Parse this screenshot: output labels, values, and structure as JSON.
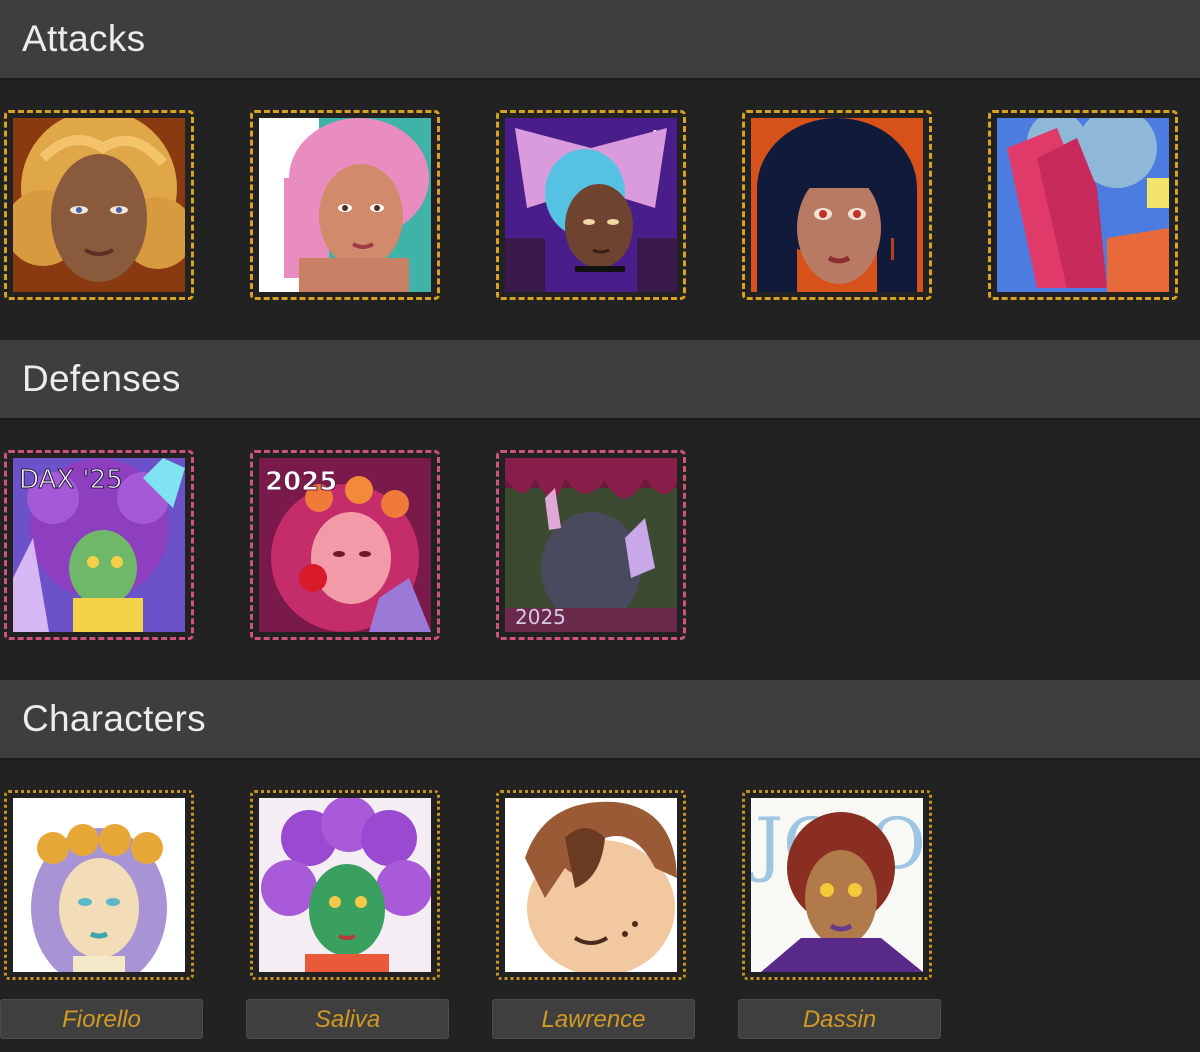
{
  "sections": {
    "attacks": {
      "title": "Attacks"
    },
    "defenses": {
      "title": "Defenses"
    },
    "characters": {
      "title": "Characters"
    }
  },
  "characters": [
    {
      "name": "Fiorello"
    },
    {
      "name": "Saliva"
    },
    {
      "name": "Lawrence"
    },
    {
      "name": "Dassin"
    }
  ],
  "defense_art_text": [
    "DAX '25",
    "2025",
    "2025"
  ],
  "character_art_text": [
    "JOJO"
  ],
  "colors": {
    "background": "#222222",
    "header_bg": "#3e3e3e",
    "header_text": "#ececec",
    "attack_border": "#d9a21c",
    "defense_border": "#d0527e",
    "character_border": "#c9941c",
    "name_text": "#d19a22"
  }
}
